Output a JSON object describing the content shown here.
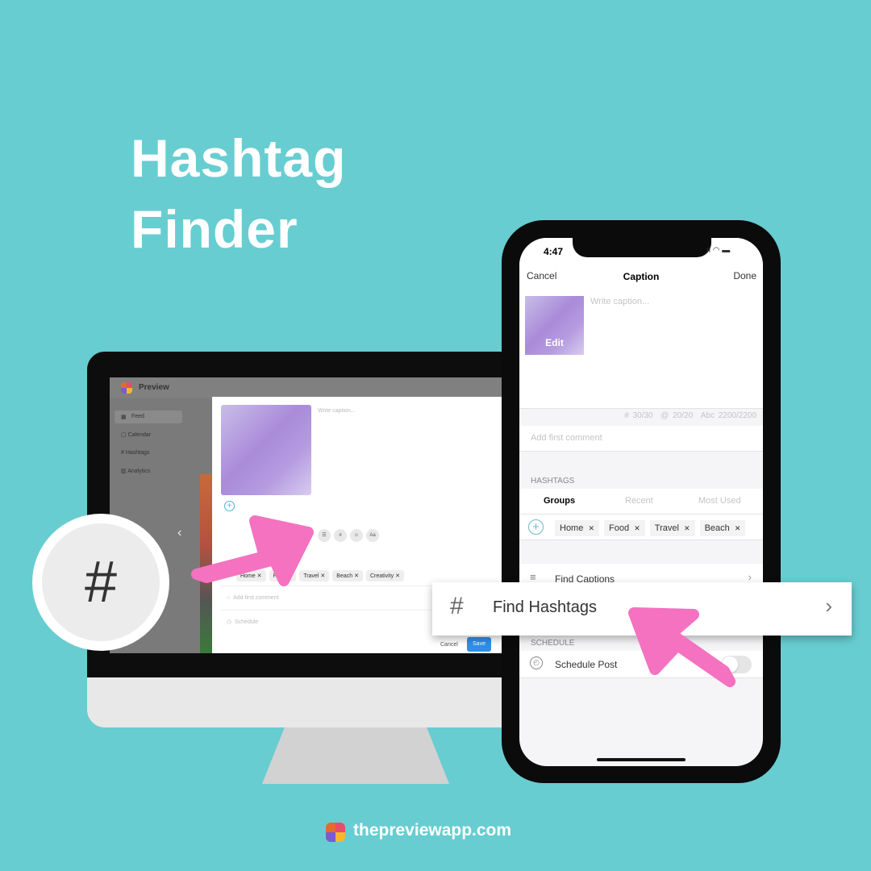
{
  "title": {
    "line1": "Hashtag",
    "line2": "Finder"
  },
  "colors": {
    "background": "#67cdd1",
    "arrow": "#f472c0",
    "save": "#2f8fe8"
  },
  "desktop": {
    "app_name": "Preview",
    "sidebar": [
      {
        "icon": "grid-icon",
        "label": "Feed"
      },
      {
        "icon": "calendar-icon",
        "label": "Calendar"
      },
      {
        "icon": "hash-icon",
        "label": "Hashtags"
      },
      {
        "icon": "chart-icon",
        "label": "Analytics"
      }
    ],
    "caption_placeholder": "Write caption...",
    "toolbar": [
      {
        "icon": "captions-icon",
        "label": "☰"
      },
      {
        "icon": "hash-icon",
        "label": "#"
      },
      {
        "icon": "emoji-icon",
        "label": "☺"
      },
      {
        "icon": "font-icon",
        "label": "Aa"
      }
    ],
    "chips": [
      "Home",
      "Food",
      "Travel",
      "Beach",
      "Creativity"
    ],
    "comment_placeholder": "Add first comment",
    "schedule": "Schedule",
    "cancel": "Cancel",
    "save": "Save"
  },
  "phone": {
    "time": "4:47",
    "cancel": "Cancel",
    "title": "Caption",
    "done": "Done",
    "edit": "Edit",
    "caption_placeholder": "Write caption...",
    "counts": {
      "hashtags": "# 30/30",
      "mentions": "@ 20/20",
      "chars": "Abc 2200/2200"
    },
    "comment_placeholder": "Add first comment",
    "hashtags_header": "HASHTAGS",
    "tabs": [
      "Groups",
      "Recent",
      "Most Used"
    ],
    "chips": [
      "Home",
      "Food",
      "Travel",
      "Beach"
    ],
    "find_captions": "Find Captions",
    "schedule_header": "SCHEDULE",
    "schedule_post": "Schedule Post",
    "schedule_enabled": false
  },
  "callout": {
    "hash": "#",
    "label": "Find Hashtags"
  },
  "footer": {
    "url": "thepreviewapp.com"
  }
}
